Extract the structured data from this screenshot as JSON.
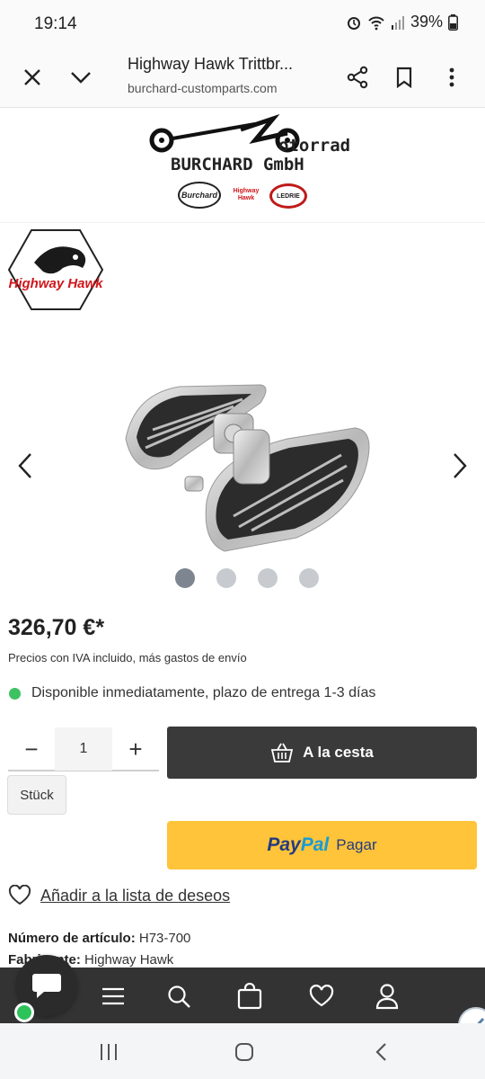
{
  "status_bar": {
    "time": "19:14",
    "battery": "39%"
  },
  "browser": {
    "title": "Highway Hawk Trittbr...",
    "url": "burchard-customparts.com",
    "icons": [
      "close-icon",
      "chevron-down-icon",
      "share-icon",
      "bookmark-icon",
      "more-vertical-icon"
    ]
  },
  "site": {
    "brand": "BURCHARD GmbH",
    "brand_suffix": "otorrad",
    "partner_logos": [
      "Burchard",
      "Highway Hawk",
      "LEDRIE"
    ]
  },
  "product": {
    "manufacturer_logo": "Highway Hawk",
    "gallery": {
      "image_count": 4,
      "active_index": 0
    },
    "price": "326,70 €*",
    "tax_note": "Precios con IVA incluido, más gastos de envío",
    "availability": "Disponible inmediatamente, plazo de entrega 1-3 días",
    "availability_color": "#3cc261"
  },
  "purchase": {
    "quantity": "1",
    "unit": "Stück",
    "minus": "−",
    "plus": "+",
    "cart_label": "A la cesta",
    "paypal_pay": "Pay",
    "paypal_pal": "Pal",
    "paypal_label": "Pagar",
    "wishlist_label": "Añadir a la lista de deseos"
  },
  "details": {
    "article_number_label": "Número de artículo:",
    "article_number": "H73-700",
    "manufacturer_label": "Fabricante:",
    "manufacturer": "Highway Hawk"
  },
  "bottom_nav": {
    "icons": [
      "menu-icon",
      "search-icon",
      "shopping-bag-icon",
      "heart-icon",
      "user-icon"
    ]
  },
  "colors": {
    "nav_bg": "#333333",
    "cart_bg": "#3a3a3a",
    "paypal_bg": "#ffc43a",
    "paypal_dark": "#253b80",
    "paypal_light": "#179bd7"
  }
}
